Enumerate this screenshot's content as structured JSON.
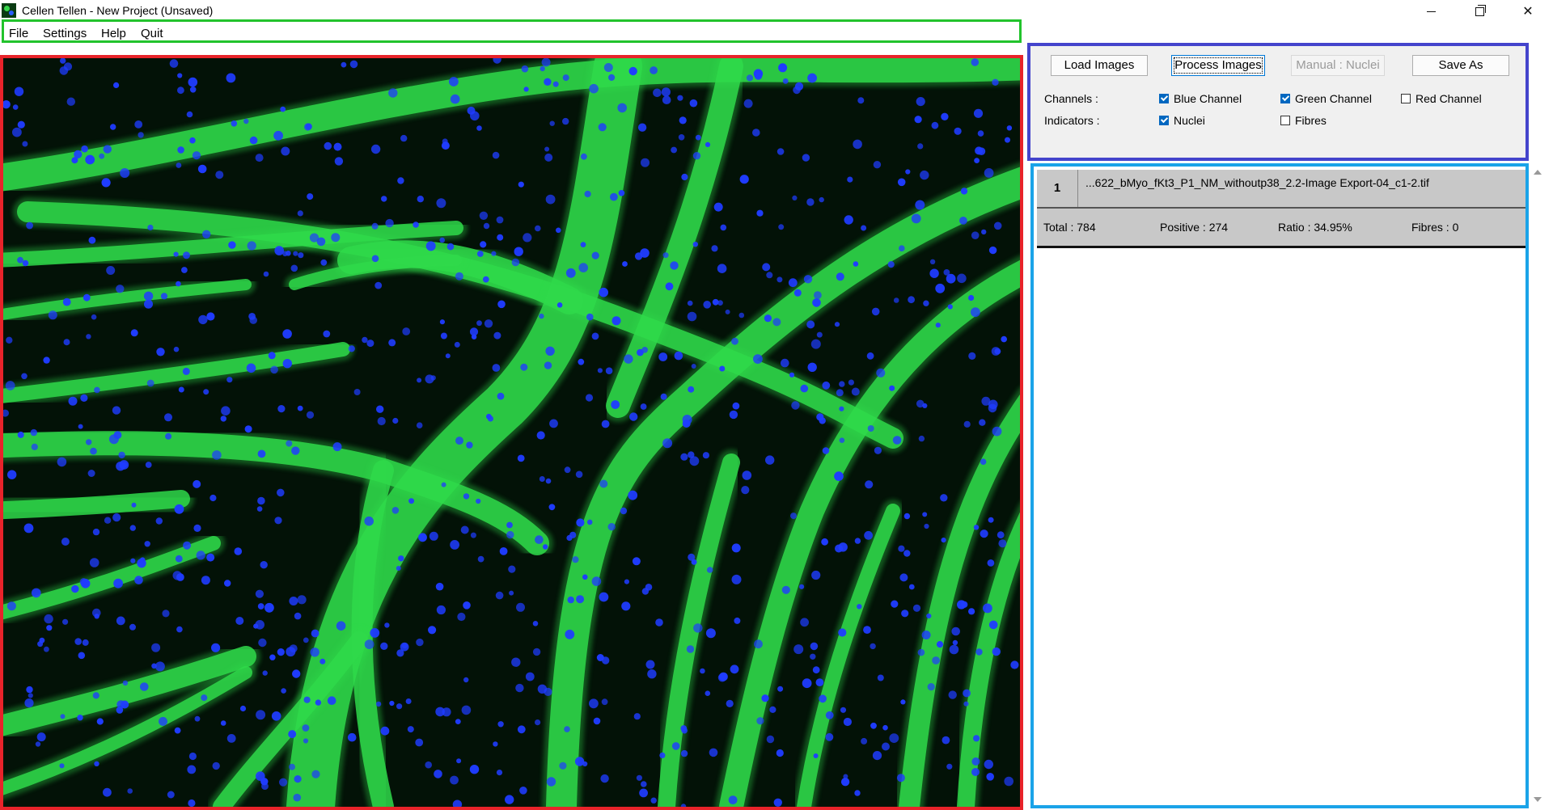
{
  "window": {
    "title": "Cellen Tellen - New Project (Unsaved)"
  },
  "menu": {
    "items": [
      "File",
      "Settings",
      "Help",
      "Quit"
    ]
  },
  "controls": {
    "buttons": {
      "load_images": "Load Images",
      "process_images": "Process Images",
      "manual_nuclei": "Manual : Nuclei",
      "save_as": "Save As"
    },
    "channels_label": "Channels :",
    "indicators_label": "Indicators :",
    "channels": [
      {
        "label": "Blue Channel",
        "checked": true
      },
      {
        "label": "Green Channel",
        "checked": true
      },
      {
        "label": "Red Channel",
        "checked": false
      }
    ],
    "indicators": [
      {
        "label": "Nuclei",
        "checked": true
      },
      {
        "label": "Fibres",
        "checked": false
      }
    ]
  },
  "results": {
    "entries": [
      {
        "index": "1",
        "filename": "...622_bMyo_fKt3_P1_NM_withoutp38_2.2-Image Export-04_c1-2.tif",
        "total": "Total : 784",
        "positive": "Positive : 274",
        "ratio": "Ratio : 34.95%",
        "fibres": "Fibres : 0"
      }
    ]
  },
  "colors": {
    "menu_border": "#22c32c",
    "viewer_border": "#e8232a",
    "controls_border": "#4444cc",
    "results_border": "#1aa3e8",
    "fibre_green": "#2fd94a",
    "nuclei_blue": "#1f3cff"
  }
}
